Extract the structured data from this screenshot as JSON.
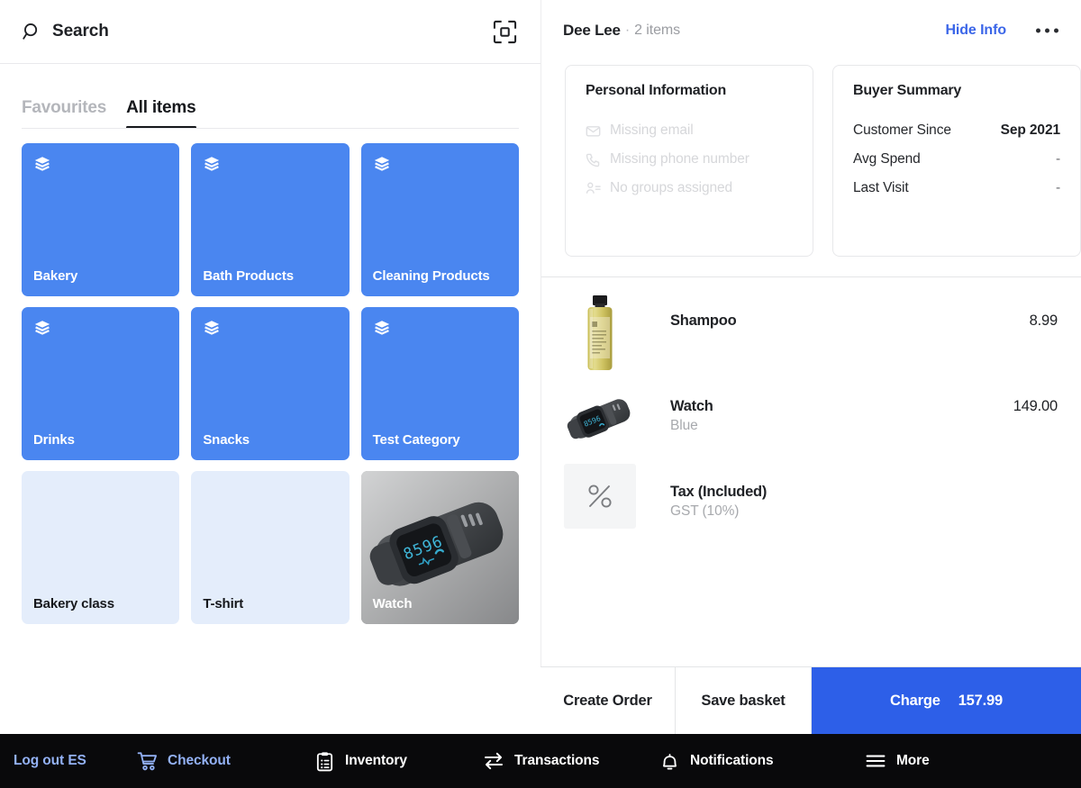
{
  "search": {
    "placeholder": "Search",
    "icon": "search-icon",
    "scan_icon": "scan-barcode-icon"
  },
  "tabs": [
    {
      "label": "Favourites",
      "active": false
    },
    {
      "label": "All items",
      "active": true
    }
  ],
  "grid": {
    "tiles": [
      {
        "label": "Bakery",
        "kind": "category",
        "icon": "layers-icon"
      },
      {
        "label": "Bath Products",
        "kind": "category",
        "icon": "layers-icon"
      },
      {
        "label": "Cleaning Products",
        "kind": "category",
        "icon": "layers-icon"
      },
      {
        "label": "Drinks",
        "kind": "category",
        "icon": "layers-icon"
      },
      {
        "label": "Snacks",
        "kind": "category",
        "icon": "layers-icon"
      },
      {
        "label": "Test Category",
        "kind": "category",
        "icon": "layers-icon"
      },
      {
        "label": "Bakery class",
        "kind": "product",
        "icon": ""
      },
      {
        "label": "T-shirt",
        "kind": "product",
        "icon": ""
      },
      {
        "label": "Watch",
        "kind": "photo",
        "icon": ""
      }
    ]
  },
  "customer": {
    "name": "Dee Lee",
    "separator": "·",
    "item_count": "2 items",
    "hide_info_label": "Hide Info",
    "more_icon": "overflow-menu-icon"
  },
  "personal_information": {
    "title": "Personal Information",
    "rows": [
      {
        "icon": "envelope-icon",
        "text": "Missing email"
      },
      {
        "icon": "phone-icon",
        "text": "Missing phone number"
      },
      {
        "icon": "group-icon",
        "text": "No groups assigned"
      }
    ]
  },
  "buyer_summary": {
    "title": "Buyer Summary",
    "rows": [
      {
        "label": "Customer Since",
        "value": "Sep 2021",
        "emphasized": true
      },
      {
        "label": "Avg Spend",
        "value": "-",
        "emphasized": false
      },
      {
        "label": "Last Visit",
        "value": "-",
        "emphasized": false
      }
    ]
  },
  "cart": {
    "lines": [
      {
        "name": "Shampoo",
        "sub": "",
        "price": "8.99",
        "thumb": "shampoo-bottle-photo"
      },
      {
        "name": "Watch",
        "sub": "Blue",
        "price": "149.00",
        "thumb": "watch-photo"
      },
      {
        "name": "Tax (Included)",
        "sub": "GST (10%)",
        "price": "",
        "thumb": "percent-icon"
      }
    ]
  },
  "actions": {
    "create_order": "Create Order",
    "save_basket": "Save basket",
    "charge_label": "Charge",
    "charge_amount": "157.99"
  },
  "bottom_nav": {
    "items": [
      {
        "label": "Log out ES",
        "icon": "",
        "accent": true
      },
      {
        "label": "Checkout",
        "icon": "cart-icon",
        "accent": true
      },
      {
        "label": "Inventory",
        "icon": "clipboard-icon",
        "accent": false
      },
      {
        "label": "Transactions",
        "icon": "transfer-icon",
        "accent": false
      },
      {
        "label": "Notifications",
        "icon": "bell-icon",
        "accent": false
      },
      {
        "label": "More",
        "icon": "hamburger-icon",
        "accent": false
      }
    ]
  },
  "colors": {
    "category_tile": "#4a86f0",
    "product_tile": "#e4edfb",
    "charge_button": "#2d5fe8",
    "link": "#3b66e8",
    "nav_background": "#09090b",
    "nav_accent": "#93b1f5"
  }
}
